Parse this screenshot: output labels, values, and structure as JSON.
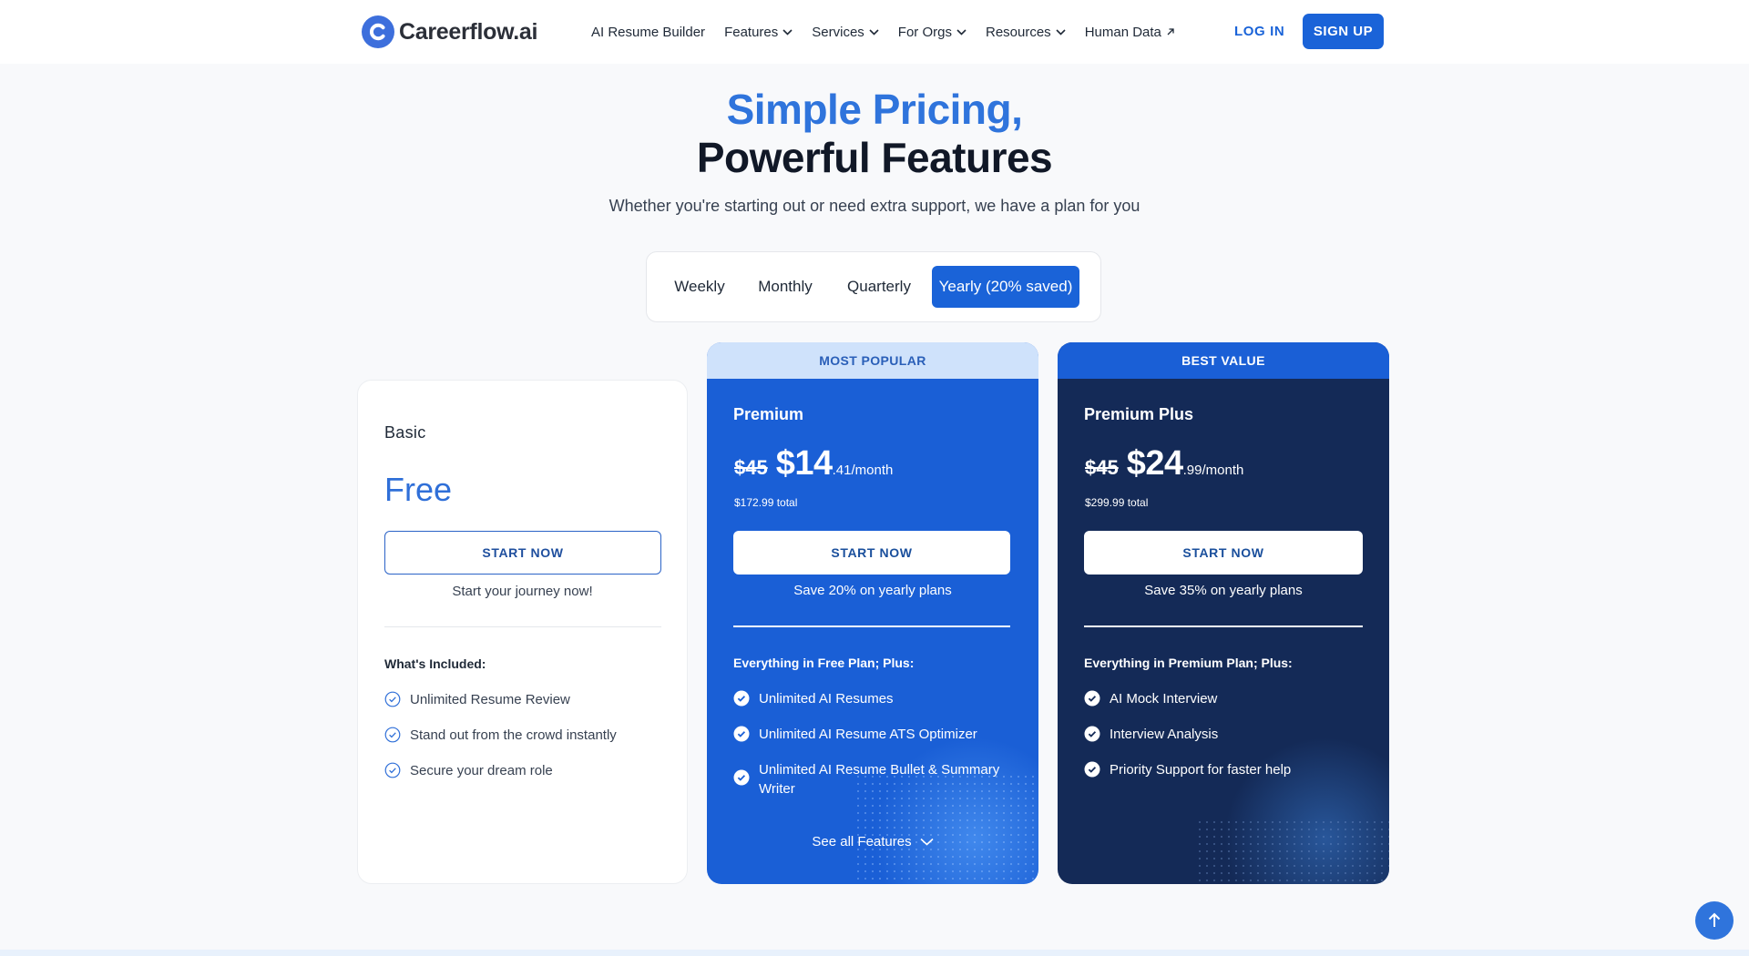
{
  "brand": {
    "name": "Careerflow.ai",
    "accent": "#1a63d8"
  },
  "nav": {
    "items": [
      {
        "label": "AI Resume Builder",
        "icon": ""
      },
      {
        "label": "Features",
        "icon": "chevron-down-icon"
      },
      {
        "label": "Services",
        "icon": "chevron-down-icon"
      },
      {
        "label": "For Orgs",
        "icon": "chevron-down-icon"
      },
      {
        "label": "Resources",
        "icon": "chevron-down-icon"
      },
      {
        "label": "Human Data",
        "icon": "external-arrow-icon"
      }
    ],
    "login": "LOG IN",
    "signup": "SIGN UP"
  },
  "hero": {
    "title_line1": "Simple Pricing,",
    "title_line2": "Powerful Features",
    "subtitle": "Whether you're starting out or need extra support, we have a plan for you"
  },
  "billing": {
    "tabs": [
      "Weekly",
      "Monthly",
      "Quarterly",
      "Yearly (20% saved)"
    ],
    "selected": "Yearly (20% saved)"
  },
  "plans": {
    "basic": {
      "name": "Basic",
      "price": "Free",
      "cta": "START NOW",
      "note": "Start your journey now!",
      "included_title": "What's Included:",
      "features": [
        "Unlimited Resume Review",
        "Stand out from the crowd instantly",
        "Secure your dream role"
      ]
    },
    "premium": {
      "ribbon": "MOST POPULAR",
      "name": "Premium",
      "old_price": "$45",
      "price": "$14",
      "price_suffix": ".41/month",
      "total": "$172.99 total",
      "cta": "START NOW",
      "note": "Save 20% on yearly plans",
      "included_title": "Everything in Free Plan; Plus:",
      "features": [
        "Unlimited AI Resumes",
        "Unlimited AI Resume ATS Optimizer",
        "Unlimited AI Resume Bullet & Summary Writer"
      ],
      "see_all": "See all Features"
    },
    "premium_plus": {
      "ribbon": "BEST VALUE",
      "name": "Premium Plus",
      "old_price": "$45",
      "price": "$24",
      "price_suffix": ".99/month",
      "total": "$299.99 total",
      "cta": "START NOW",
      "note": "Save 35% on yearly plans",
      "included_title": "Everything in Premium Plan; Plus:",
      "features": [
        "AI Mock Interview",
        "Interview Analysis",
        "Priority Support for faster help"
      ]
    }
  }
}
